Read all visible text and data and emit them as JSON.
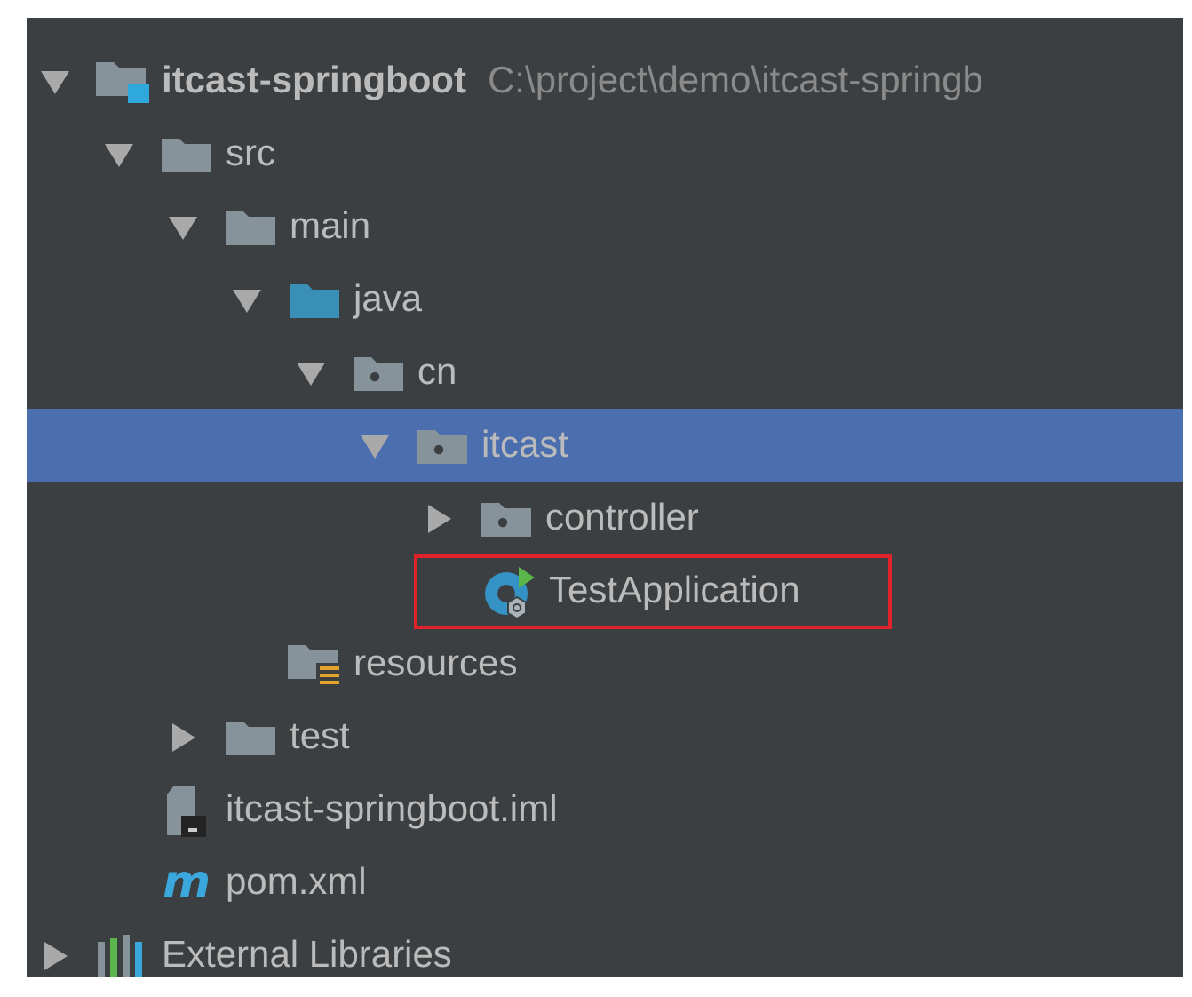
{
  "tree": [
    {
      "label": "itcast-springboot",
      "kind": "module",
      "path": "C:\\project\\demo\\itcast-springb",
      "expanded": true,
      "selected": false,
      "children": [
        {
          "label": "src",
          "kind": "folder",
          "expanded": true,
          "selected": false,
          "children": [
            {
              "label": "main",
              "kind": "folder",
              "expanded": true,
              "selected": false,
              "children": [
                {
                  "label": "java",
                  "kind": "source-folder",
                  "expanded": true,
                  "selected": false,
                  "children": [
                    {
                      "label": "cn",
                      "kind": "package",
                      "expanded": true,
                      "selected": false,
                      "children": [
                        {
                          "label": "itcast",
                          "kind": "package",
                          "expanded": true,
                          "selected": true,
                          "children": [
                            {
                              "label": "controller",
                              "kind": "package",
                              "expanded": false,
                              "selected": false
                            },
                            {
                              "label": "TestApplication",
                              "kind": "spring-class",
                              "selected": false,
                              "highlighted": true
                            }
                          ]
                        }
                      ]
                    }
                  ]
                },
                {
                  "label": "resources",
                  "kind": "resources",
                  "selected": false
                }
              ]
            },
            {
              "label": "test",
              "kind": "folder",
              "expanded": false,
              "selected": false
            }
          ]
        },
        {
          "label": "itcast-springboot.iml",
          "kind": "iml",
          "selected": false
        },
        {
          "label": "pom.xml",
          "kind": "maven",
          "icon_text": "m",
          "selected": false
        }
      ]
    },
    {
      "label": "External Libraries",
      "kind": "libraries",
      "expanded": false,
      "selected": false
    }
  ]
}
